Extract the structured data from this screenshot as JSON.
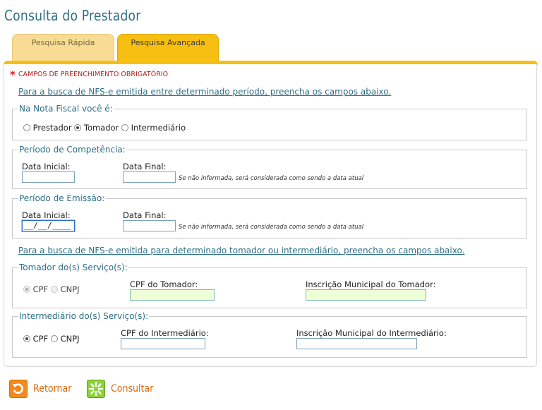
{
  "page": {
    "title": "Consulta do Prestador"
  },
  "tabs": [
    {
      "label": "Pesquisa Rápida",
      "active": false
    },
    {
      "label": "Pesquisa Avançada",
      "active": true
    }
  ],
  "required_note": "CAMPOS DE PREENCHIMENTO OBRIGATÓRIO",
  "links": {
    "period_search": "Para a busca de NFS-e emitida entre determinado período, preencha os campos abaixo.",
    "party_search": "Para a busca de NFS-e emitida para determinado tomador ou intermediário, preencha os campos abaixo."
  },
  "role": {
    "legend": "Na Nota Fiscal você é:",
    "options": [
      "Prestador",
      "Tomador",
      "Intermediário"
    ],
    "selected": "Tomador"
  },
  "competencia": {
    "legend": "Período de Competência:",
    "start_label": "Data Inicial:",
    "start_value": "",
    "end_label": "Data Final:",
    "end_value": "",
    "note": "Se não informada, será considerada como sendo a data atual"
  },
  "emissao": {
    "legend": "Período de Emissão:",
    "start_label": "Data Inicial:",
    "start_value": "__/__/____",
    "end_label": "Data Final:",
    "end_value": "",
    "note": "Se não informada, será considerada como sendo a data atual"
  },
  "tomador": {
    "legend": "Tomador do(s) Serviço(s):",
    "doc_options": [
      "CPF",
      "CNPJ"
    ],
    "doc_selected": "CPF",
    "doc_label": "CPF do Tomador:",
    "doc_value": "",
    "im_label": "Inscrição Municipal do Tomador:",
    "im_value": ""
  },
  "intermediario": {
    "legend": "Intermediário do(s) Serviço(s):",
    "doc_options": [
      "CPF",
      "CNPJ"
    ],
    "doc_selected": "CPF",
    "doc_label": "CPF do Intermediário:",
    "doc_value": "",
    "im_label": "Inscrição Municipal do Intermediário:",
    "im_value": ""
  },
  "buttons": {
    "back": "Retornar",
    "search": "Consultar"
  },
  "icons": {
    "back": "return-arrow-icon",
    "search": "search-sparkle-icon"
  },
  "colors": {
    "accent": "#f7bf12",
    "title": "#2e6f86",
    "required": "#b32020",
    "back": "#f28a1c",
    "search": "#8ed23a"
  }
}
